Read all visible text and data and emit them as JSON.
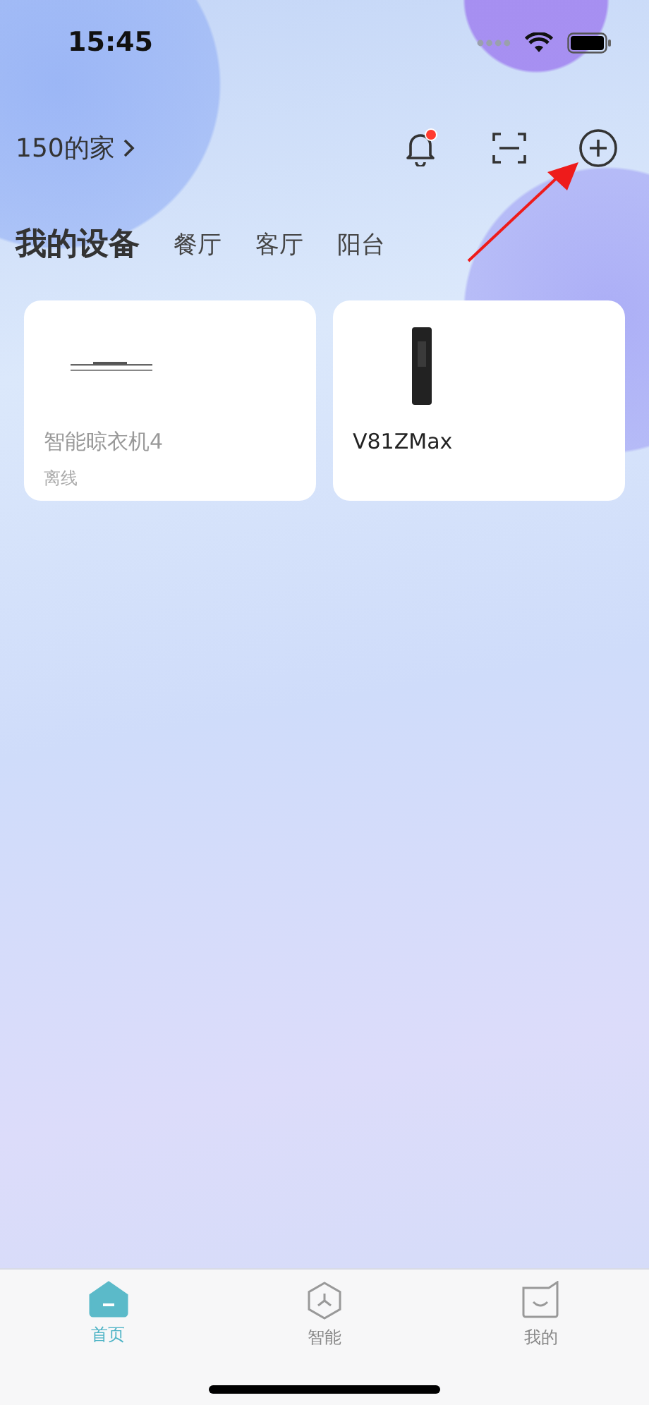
{
  "status_bar": {
    "time": "15:45"
  },
  "header": {
    "home_name": "150的家",
    "notification_unread": true
  },
  "tabs": [
    {
      "label": "我的设备",
      "selected": true
    },
    {
      "label": "餐厅",
      "selected": false
    },
    {
      "label": "客厅",
      "selected": false
    },
    {
      "label": "阳台",
      "selected": false
    }
  ],
  "devices": [
    {
      "name": "智能晾衣机4",
      "kind": "drying-rack",
      "online": false,
      "status": "离线"
    },
    {
      "name": "V81ZMax",
      "kind": "vacuum",
      "online": true
    }
  ],
  "bottom_nav": [
    {
      "label": "首页",
      "kind": "home",
      "selected": true
    },
    {
      "label": "智能",
      "kind": "smart",
      "selected": false
    },
    {
      "label": "我的",
      "kind": "profile",
      "selected": false
    }
  ]
}
